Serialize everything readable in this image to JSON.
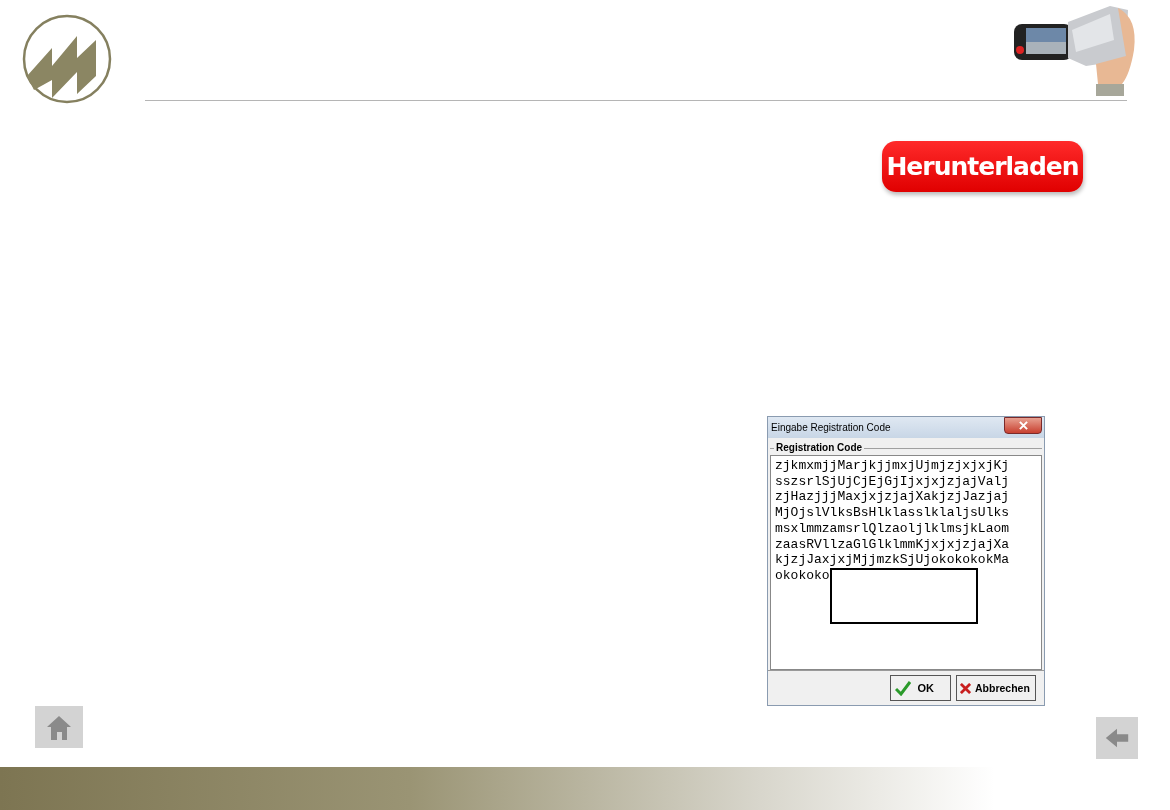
{
  "download_button": {
    "label": "Herunterladen"
  },
  "dialog": {
    "title": "Eingabe Registration Code",
    "group_label": "Registration Code",
    "code_lines": [
      "zjkmxmjjMarjkjjmxjUjmjzjxjxjKj",
      "sszsrlSjUjCjEjGjIjxjxjzjajValj",
      "zjHazjjjMaxjxjzjajXakjzjJazjaj",
      "MjOjslVlksBsHlklasslklaljsUlks",
      "msxlmmzamsrlQlzaoljlklmsjkLaom",
      "zaasRVllzaGlGlklmmKjxjxjzjajXa",
      "kjzjJaxjxjMjjmzkSjUjokokokokMa",
      "okokoko"
    ],
    "buttons": [
      {
        "label": "OK",
        "kind": "ok"
      },
      {
        "label": "Abbrechen",
        "kind": "cancel"
      }
    ]
  }
}
